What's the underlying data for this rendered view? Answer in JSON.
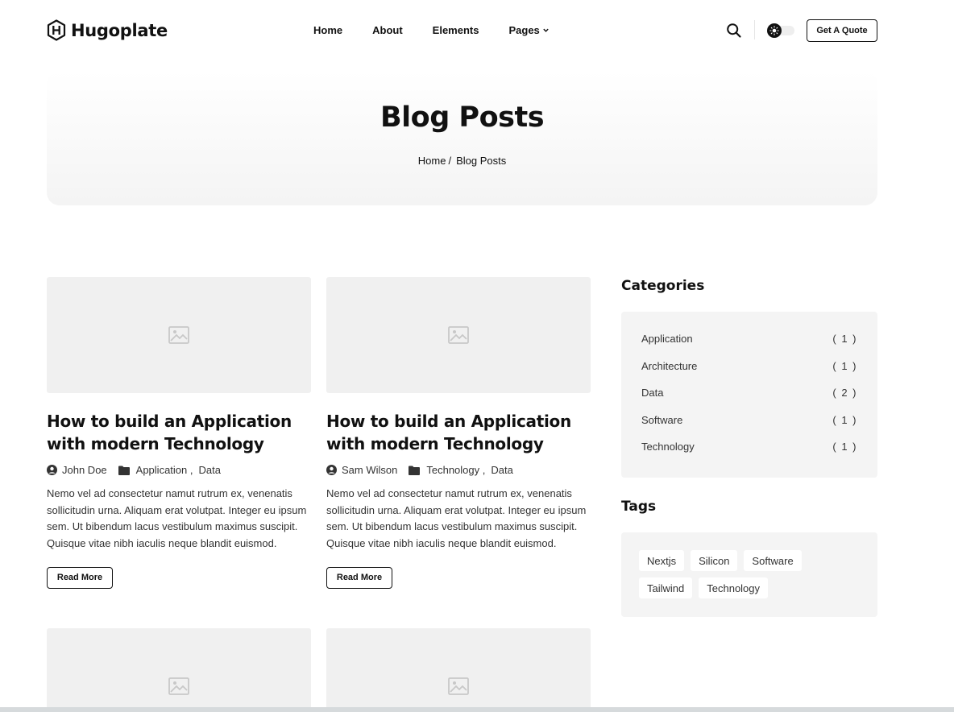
{
  "header": {
    "logo_text": "Hugoplate",
    "nav": [
      {
        "label": "Home"
      },
      {
        "label": "About"
      },
      {
        "label": "Elements"
      },
      {
        "label": "Pages"
      }
    ],
    "quote_button": "Get A Quote",
    "icons": {
      "search": "search-icon",
      "theme": "sun-icon",
      "dropdown": "chevron-down-icon"
    }
  },
  "hero": {
    "title": "Blog Posts",
    "breadcrumb": [
      {
        "label": "Home"
      },
      {
        "label": "Blog Posts"
      }
    ],
    "separator": "/"
  },
  "posts": [
    {
      "title": "How to build an Application with modern Technology",
      "author": "John Doe",
      "categories": [
        "Application",
        "Data"
      ],
      "excerpt": "Nemo vel ad consectetur namut rutrum ex, venenatis sollicitudin urna. Aliquam erat volutpat. Integer eu ipsum sem. Ut bibendum lacus vestibulum maximus suscipit. Quisque vitae nibh iaculis neque blandit euismod.",
      "button": "Read More"
    },
    {
      "title": "How to build an Application with modern Technology",
      "author": "Sam Wilson",
      "categories": [
        "Technology",
        "Data"
      ],
      "excerpt": "Nemo vel ad consectetur namut rutrum ex, venenatis sollicitudin urna. Aliquam erat volutpat. Integer eu ipsum sem. Ut bibendum lacus vestibulum maximus suscipit. Quisque vitae nibh iaculis neque blandit euismod.",
      "button": "Read More"
    }
  ],
  "sidebar": {
    "categories_heading": "Categories",
    "categories": [
      {
        "name": "Application",
        "count": "( 1 )"
      },
      {
        "name": "Architecture",
        "count": "( 1 )"
      },
      {
        "name": "Data",
        "count": "( 2 )"
      },
      {
        "name": "Software",
        "count": "( 1 )"
      },
      {
        "name": "Technology",
        "count": "( 1 )"
      }
    ],
    "tags_heading": "Tags",
    "tags": [
      "Nextjs",
      "Silicon",
      "Software",
      "Tailwind",
      "Technology"
    ]
  },
  "colors": {
    "text": "#111111",
    "muted_bg": "#f4f4f4",
    "placeholder_bg": "#f0f0f0",
    "border": "#111111"
  }
}
